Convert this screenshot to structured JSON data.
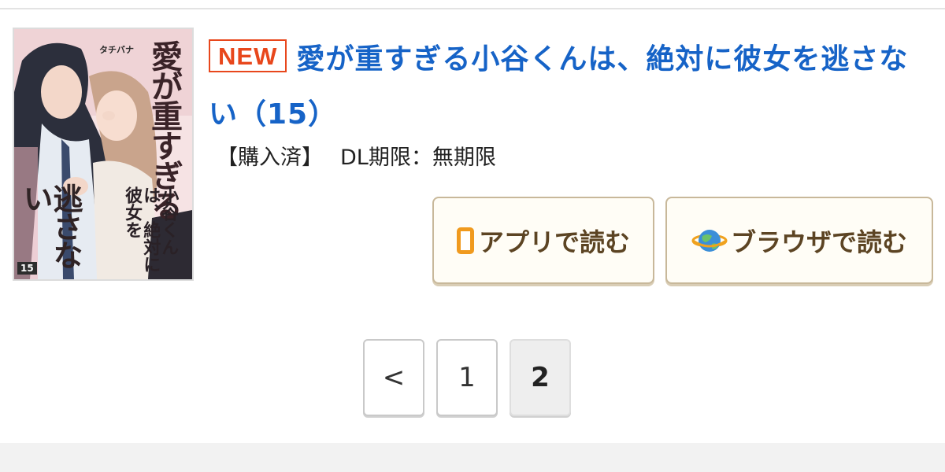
{
  "item": {
    "cover": {
      "title_part1": "愛が重すぎる",
      "title_part2": "逃さない",
      "subtitle": "小谷くんは、絶対に彼女を",
      "author": "タチバナ",
      "volume_label": "15"
    },
    "badge": "NEW",
    "title": "愛が重すぎる小谷くんは、絶対に彼女を逃さない（15）",
    "status": "【購入済】",
    "dl_limit_label": "DL期限：無期限",
    "buttons": {
      "app_read": "アプリで読む",
      "browser_read": "ブラウザで読む"
    },
    "icons": {
      "app": "smartphone-icon",
      "browser": "globe-icon"
    }
  },
  "pagination": {
    "prev_label": "<",
    "pages": [
      "1",
      "2"
    ],
    "current_page": "2"
  },
  "colors": {
    "title_link": "#1663c7",
    "new_badge": "#e8471c",
    "button_text": "#5c4423",
    "button_border": "#c8b89a",
    "app_icon": "#f09a1e"
  }
}
